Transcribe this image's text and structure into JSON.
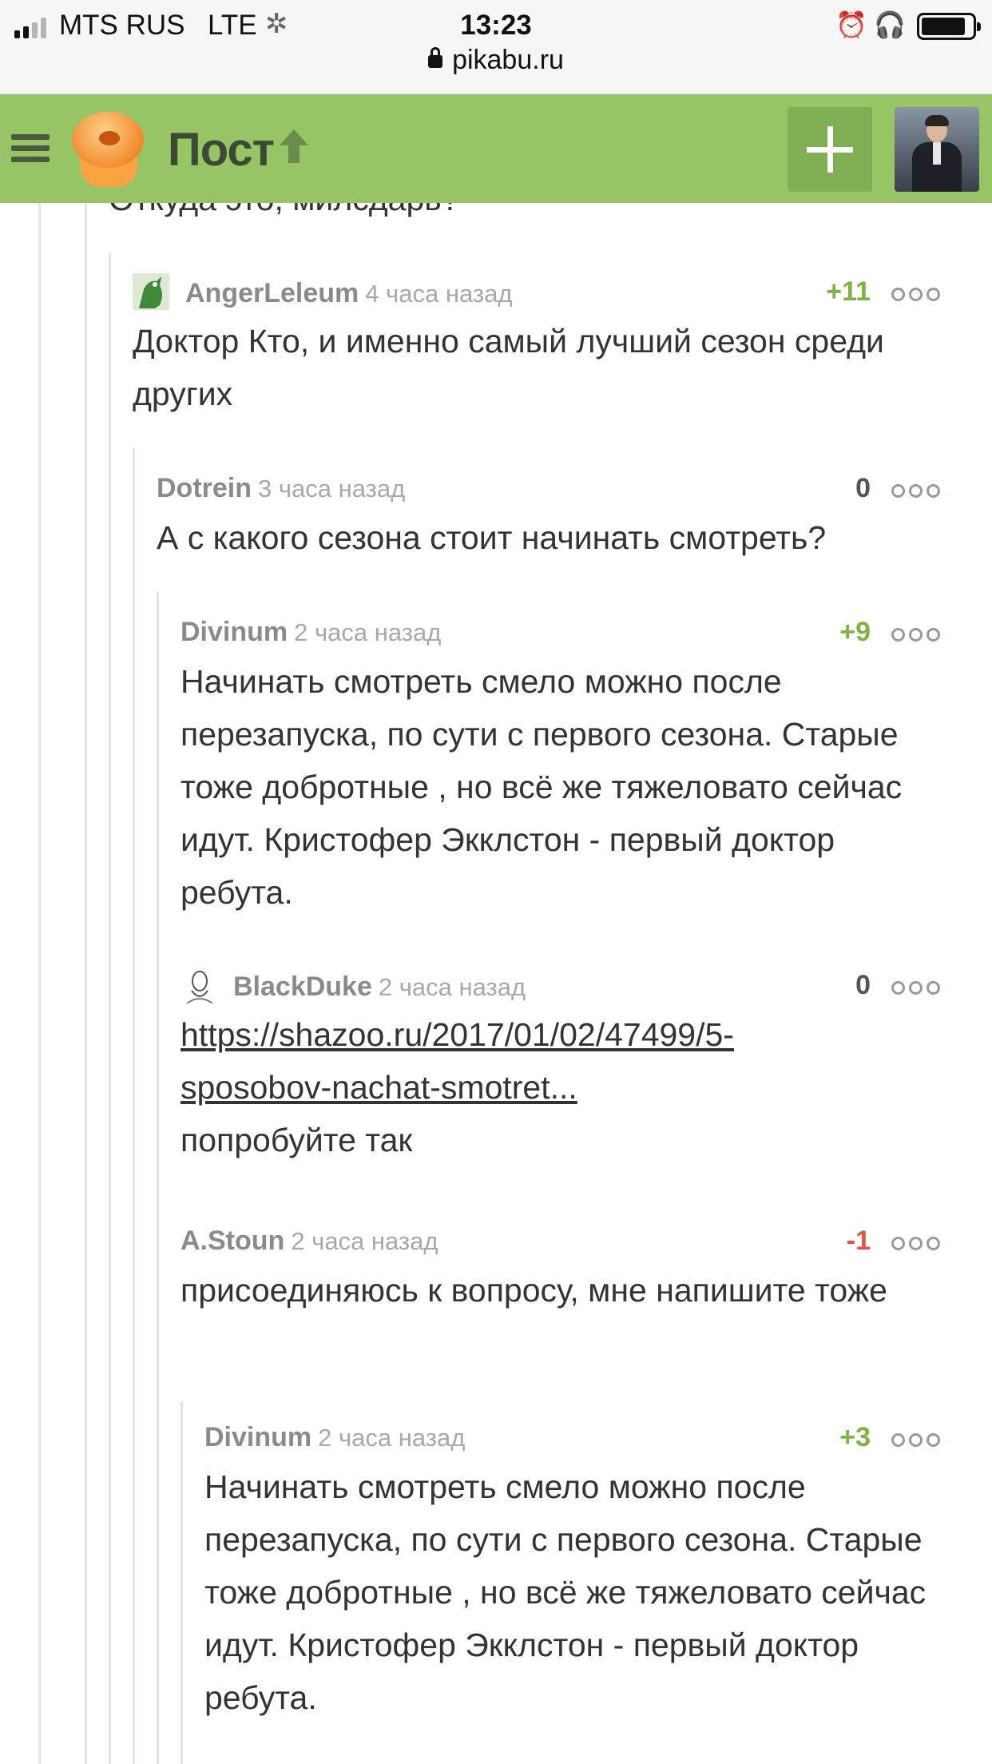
{
  "status_bar": {
    "carrier": "MTS RUS",
    "network": "LTE",
    "time": "13:23",
    "url": "pikabu.ru"
  },
  "header": {
    "title": "Пост",
    "icons": [
      "menu-icon",
      "pikabu-logo",
      "arrow-up-icon",
      "plus-icon",
      "user-avatar"
    ]
  },
  "previous_text": "Откуда это, милсдарь?",
  "comments": [
    {
      "author": "AngerLeleum",
      "time": "4 часа назад",
      "rating": "+11",
      "text": "Доктор Кто, и именно самый лучший сезон среди других"
    },
    {
      "author": "Dotrein",
      "time": "3 часа назад",
      "rating": "0",
      "text": "А с какого сезона стоит начинать смотреть?"
    },
    {
      "author": "Divinum",
      "time": "2 часа назад",
      "rating": "+9",
      "text": "Начинать смотреть смело можно после перезапуска, по сути с первого сезона. Старые тоже добротные , но всё же тяжеловато сейчас идут. Кристофер Экклстон - первый доктор ребута."
    },
    {
      "author": "BlackDuke",
      "time": "2 часа назад",
      "rating": "0",
      "link_line1": "https://shazoo.ru/2017/01/02/47499/5-",
      "link_line2": "sposobov-nachat-smotret...",
      "text": "попробуйте так"
    },
    {
      "author": "A.Stoun",
      "time": "2 часа назад",
      "rating": "-1",
      "text": "присоединяюсь к вопросу, мне напишите тоже"
    },
    {
      "author": "Divinum",
      "time": "2 часа назад",
      "rating": "+3",
      "text": "Начинать смотреть смело можно после перезапуска, по сути с первого сезона. Старые тоже добротные , но всё же тяжеловато сейчас идут. Кристофер Экклстон - первый доктор ребута."
    }
  ],
  "colors": {
    "header_green": "#97c566",
    "positive": "#7cb342",
    "negative": "#e3563b"
  }
}
